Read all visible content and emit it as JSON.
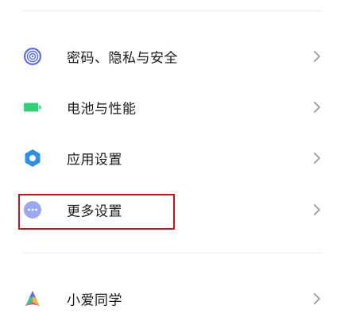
{
  "settings": {
    "items": [
      {
        "label": "密码、隐私与安全",
        "icon": "fingerprint-icon",
        "icon_color": "#5b6be8"
      },
      {
        "label": "电池与性能",
        "icon": "battery-icon",
        "icon_color": "#37d07a"
      },
      {
        "label": "应用设置",
        "icon": "gear-icon",
        "icon_color": "#2f8fe6"
      },
      {
        "label": "更多设置",
        "icon": "more-dots-icon",
        "icon_color": "#9aa8ef"
      },
      {
        "label": "小爱同学",
        "icon": "xiaoai-icon",
        "icon_color": "#3fbf8c"
      }
    ],
    "highlight_color": "#c0161e"
  }
}
